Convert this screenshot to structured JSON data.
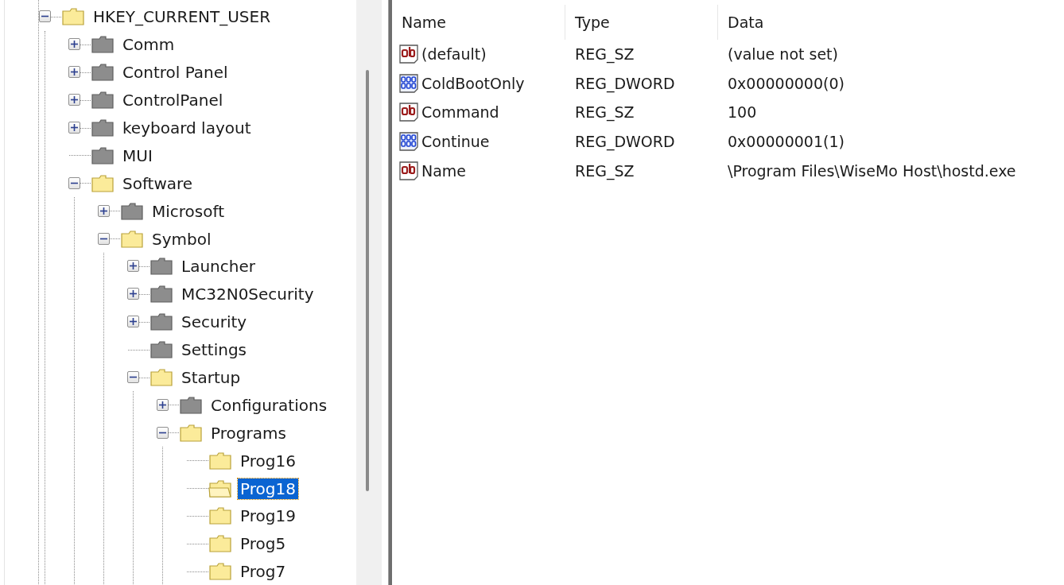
{
  "tree": [
    {
      "label": "HKEY_CURRENT_USER",
      "expanded": true,
      "loaded": true,
      "selected": false,
      "children": [
        {
          "label": "Comm",
          "expanded": false,
          "loaded": false,
          "selected": false
        },
        {
          "label": "Control Panel",
          "expanded": false,
          "loaded": false,
          "selected": false
        },
        {
          "label": "ControlPanel",
          "expanded": false,
          "loaded": false,
          "selected": false
        },
        {
          "label": "keyboard layout",
          "expanded": false,
          "loaded": false,
          "selected": false
        },
        {
          "label": "MUI",
          "loaded": false,
          "selected": false
        },
        {
          "label": "Software",
          "expanded": true,
          "loaded": true,
          "selected": false,
          "children": [
            {
              "label": "Microsoft",
              "expanded": false,
              "loaded": false,
              "selected": false
            },
            {
              "label": "Symbol",
              "expanded": true,
              "loaded": true,
              "selected": false,
              "children": [
                {
                  "label": "Launcher",
                  "expanded": false,
                  "loaded": false,
                  "selected": false
                },
                {
                  "label": "MC32N0Security",
                  "expanded": false,
                  "loaded": false,
                  "selected": false
                },
                {
                  "label": "Security",
                  "expanded": false,
                  "loaded": false,
                  "selected": false
                },
                {
                  "label": "Settings",
                  "loaded": false,
                  "selected": false
                },
                {
                  "label": "Startup",
                  "expanded": true,
                  "loaded": true,
                  "selected": false,
                  "children": [
                    {
                      "label": "Configurations",
                      "expanded": false,
                      "loaded": false,
                      "selected": false
                    },
                    {
                      "label": "Programs",
                      "expanded": true,
                      "loaded": true,
                      "selected": false,
                      "children": [
                        {
                          "label": "Prog16",
                          "loaded": true,
                          "selected": false
                        },
                        {
                          "label": "Prog18",
                          "loaded": true,
                          "selected": true
                        },
                        {
                          "label": "Prog19",
                          "loaded": true,
                          "selected": false
                        },
                        {
                          "label": "Prog5",
                          "loaded": true,
                          "selected": false
                        },
                        {
                          "label": "Prog7",
                          "loaded": true,
                          "selected": false
                        }
                      ]
                    }
                  ]
                }
              ]
            }
          ]
        }
      ]
    }
  ],
  "list": {
    "columns": [
      "Name",
      "Type",
      "Data"
    ],
    "rows": [
      {
        "kind": "string",
        "name": "(default)",
        "type": "REG_SZ",
        "data": "(value not set)"
      },
      {
        "kind": "dword",
        "name": "ColdBootOnly",
        "type": "REG_DWORD",
        "data": "0x00000000(0)"
      },
      {
        "kind": "string",
        "name": "Command",
        "type": "REG_SZ",
        "data": "100"
      },
      {
        "kind": "dword",
        "name": "Continue",
        "type": "REG_DWORD",
        "data": "0x00000001(1)"
      },
      {
        "kind": "string",
        "name": "Name",
        "type": "REG_SZ",
        "data": "\\Program Files\\WiseMo Host\\hostd.exe"
      }
    ]
  }
}
